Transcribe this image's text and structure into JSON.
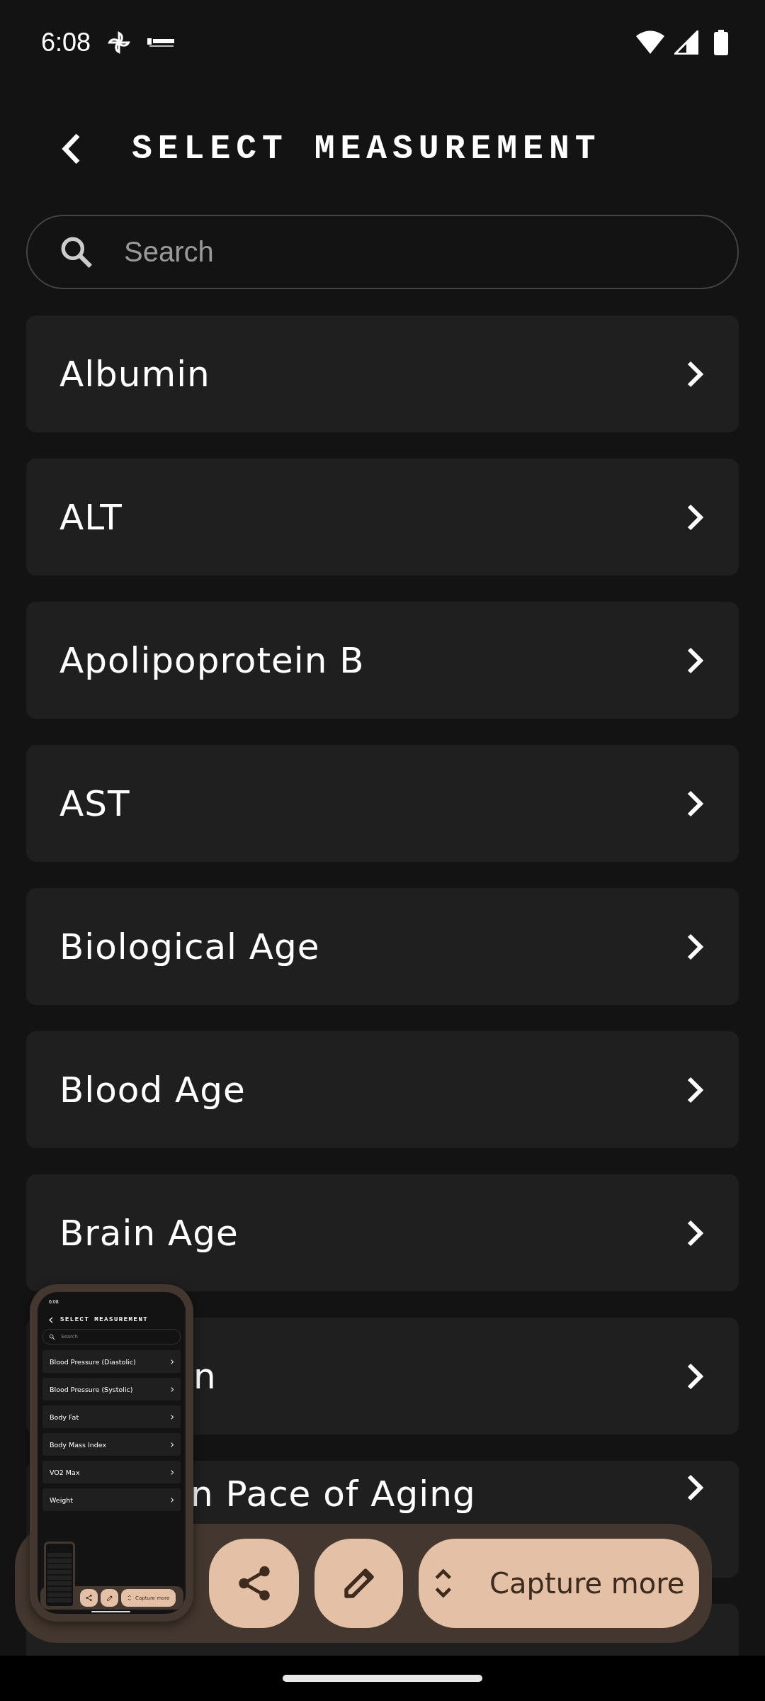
{
  "status_bar": {
    "time": "6:08"
  },
  "header": {
    "title": "SELECT MEASUREMENT"
  },
  "search": {
    "placeholder": "Search"
  },
  "items": [
    {
      "label": "Albumin",
      "kind": "full"
    },
    {
      "label": "ALT",
      "kind": "full"
    },
    {
      "label": "Apolipoprotein B",
      "kind": "full"
    },
    {
      "label": "AST",
      "kind": "full"
    },
    {
      "label": "Biological Age",
      "kind": "full"
    },
    {
      "label": "Blood Age",
      "kind": "full"
    },
    {
      "label": "Brain Age",
      "kind": "full"
    },
    {
      "label": "n",
      "kind": "covered"
    },
    {
      "label": "n Pace of Aging",
      "kind": "clipped"
    },
    {
      "kind": "edge"
    }
  ],
  "preview": {
    "time": "6:08",
    "title": "SELECT MEASUREMENT",
    "search_placeholder": "Search",
    "items": [
      "Blood Pressure (Diastolic)",
      "Blood Pressure (Systolic)",
      "Body Fat",
      "Body Mass Index",
      "VO2 Max",
      "Weight"
    ],
    "capture_label": "Capture more"
  },
  "action_bar": {
    "capture_label": "Capture more"
  }
}
